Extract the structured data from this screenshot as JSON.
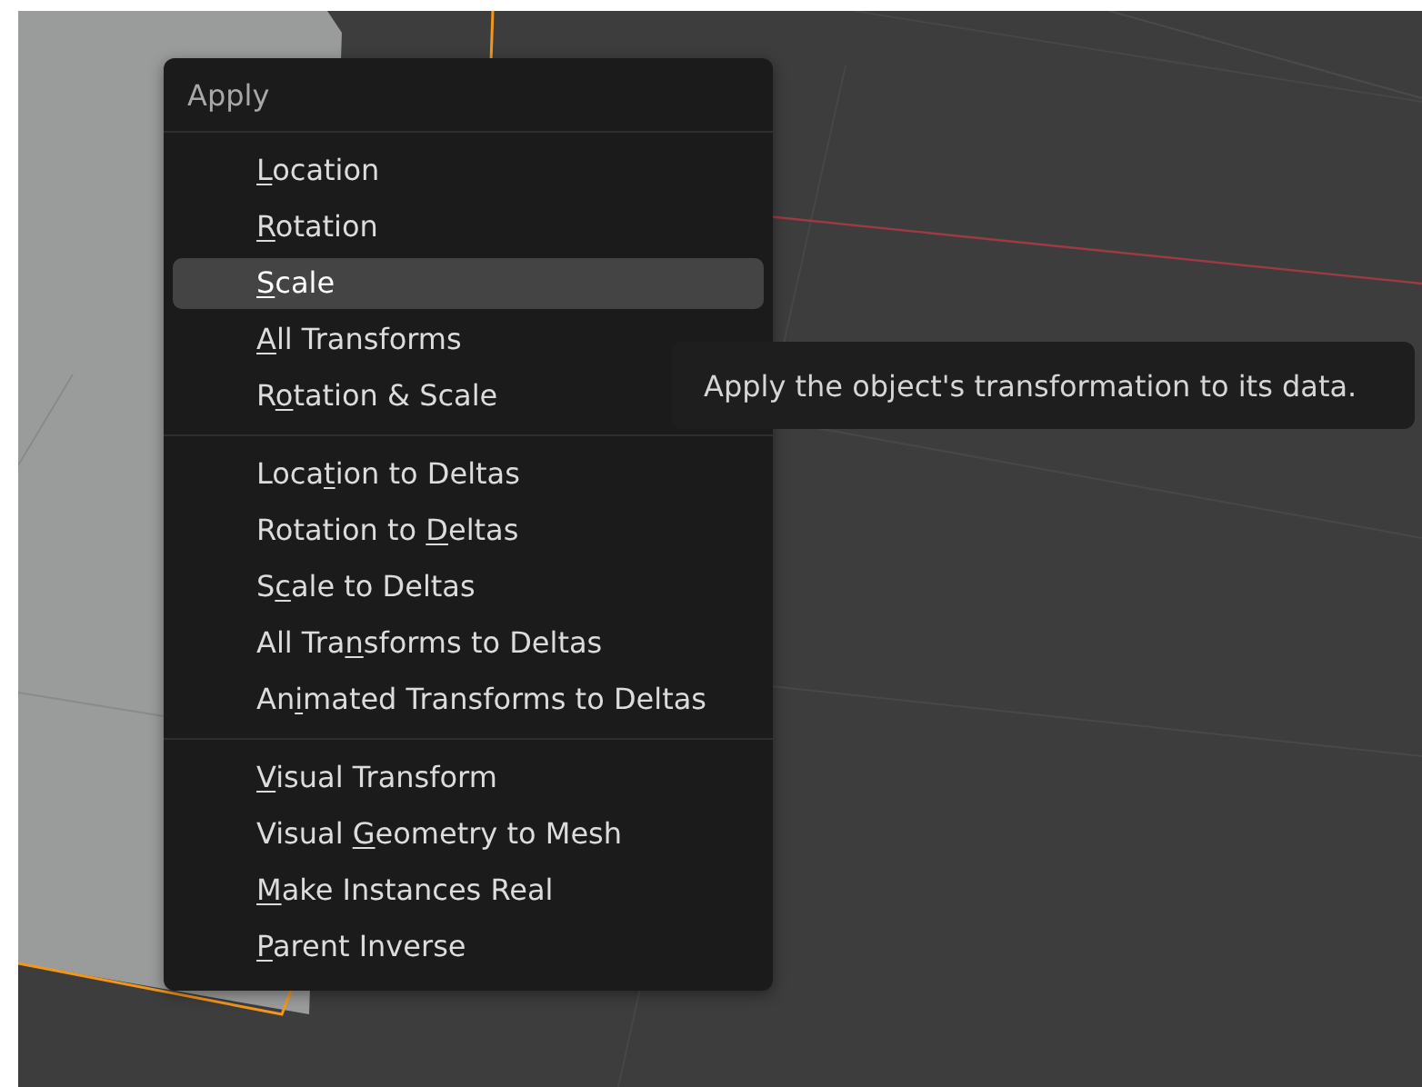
{
  "menu": {
    "title": "Apply",
    "sections": [
      [
        {
          "key": "L",
          "after": "ocation",
          "selected": false
        },
        {
          "key": "R",
          "after": "otation",
          "selected": false
        },
        {
          "key": "S",
          "after": "cale",
          "selected": true
        },
        {
          "key": "A",
          "after": "ll Transforms",
          "selected": false
        },
        {
          "before": "R",
          "key": "o",
          "after": "tation & Scale",
          "selected": false
        }
      ],
      [
        {
          "before": "Loca",
          "key": "t",
          "after": "ion to Deltas",
          "selected": false
        },
        {
          "before": "Rotation to ",
          "key": "D",
          "after": "eltas",
          "selected": false
        },
        {
          "before": "S",
          "key": "c",
          "after": "ale to Deltas",
          "selected": false
        },
        {
          "before": "All Tra",
          "key": "n",
          "after": "sforms to Deltas",
          "selected": false
        },
        {
          "before": "An",
          "key": "i",
          "after": "mated Transforms to Deltas",
          "selected": false
        }
      ],
      [
        {
          "key": "V",
          "after": "isual Transform",
          "selected": false
        },
        {
          "before": "Visual ",
          "key": "G",
          "after": "eometry to Mesh",
          "selected": false
        },
        {
          "key": "M",
          "after": "ake Instances Real",
          "selected": false
        },
        {
          "key": "P",
          "after": "arent Inverse",
          "selected": false
        }
      ]
    ]
  },
  "tooltip": {
    "text": "Apply the object's transformation to its data."
  }
}
